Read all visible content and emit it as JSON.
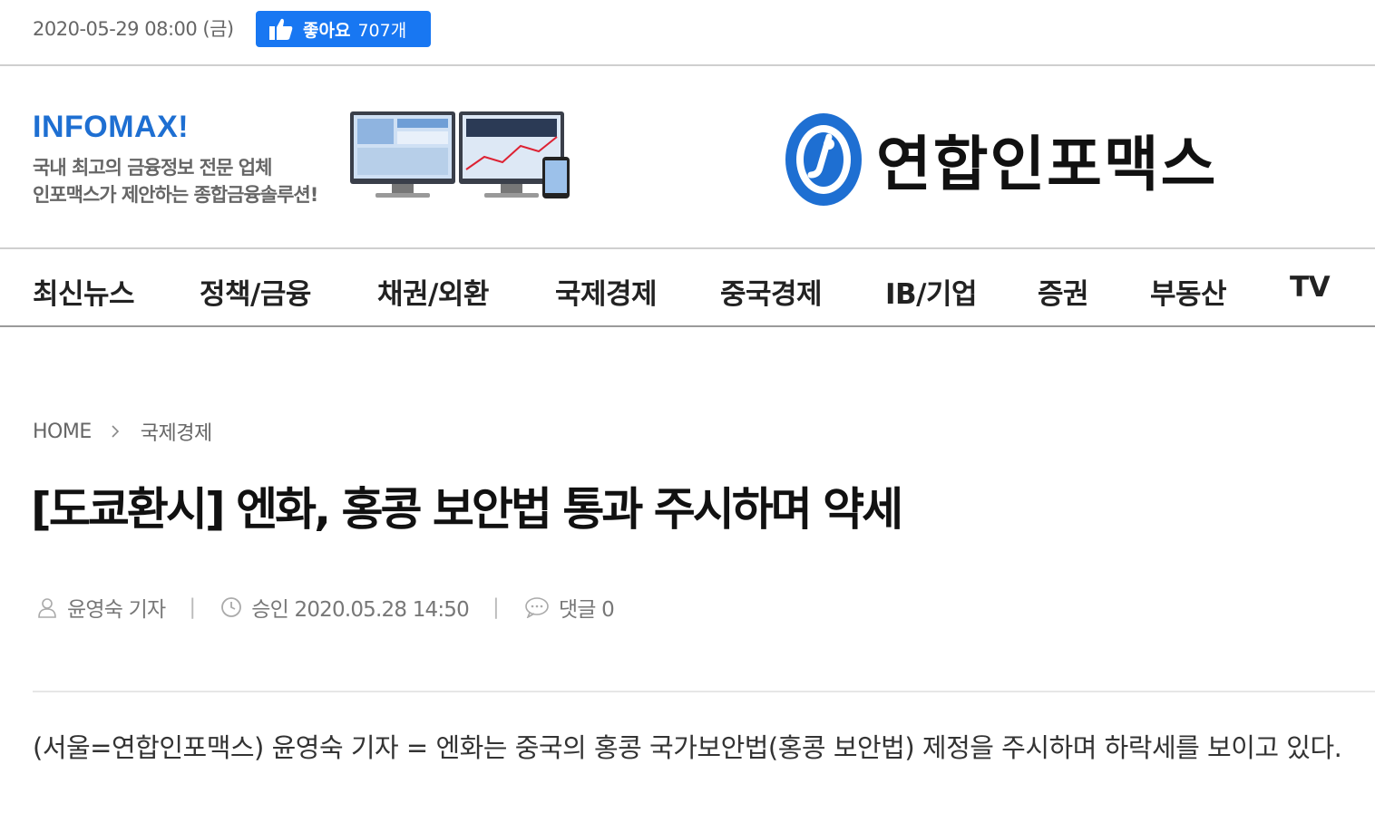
{
  "topbar": {
    "date": "2020-05-29 08:00 (금)",
    "like_label": "좋아요",
    "like_count": "707개",
    "like_color": "#1877f2"
  },
  "banner": {
    "ad_title": "INFOMAX!",
    "ad_line1": "국내 최고의 금융정보 전문 업체",
    "ad_line2": "인포맥스가 제안하는 종합금융솔루션!",
    "logo_text": "연합인포맥스",
    "brand_color": "#1e6fd2"
  },
  "nav": {
    "items": [
      "최신뉴스",
      "정책/금융",
      "채권/외환",
      "국제경제",
      "중국경제",
      "IB/기업",
      "증권",
      "부동산",
      "TV"
    ]
  },
  "breadcrumb": {
    "home": "HOME",
    "section": "국제경제"
  },
  "article": {
    "headline": "[도쿄환시] 엔화, 홍콩 보안법 통과 주시하며 약세",
    "author": "윤영숙 기자",
    "approved": "승인 2020.05.28 14:50",
    "comments": "댓글 0",
    "body": "(서울=연합인포맥스) 윤영숙 기자 = 엔화는 중국의 홍콩 국가보안법(홍콩 보안법) 제정을 주시하며 하락세를 보이고 있다."
  }
}
